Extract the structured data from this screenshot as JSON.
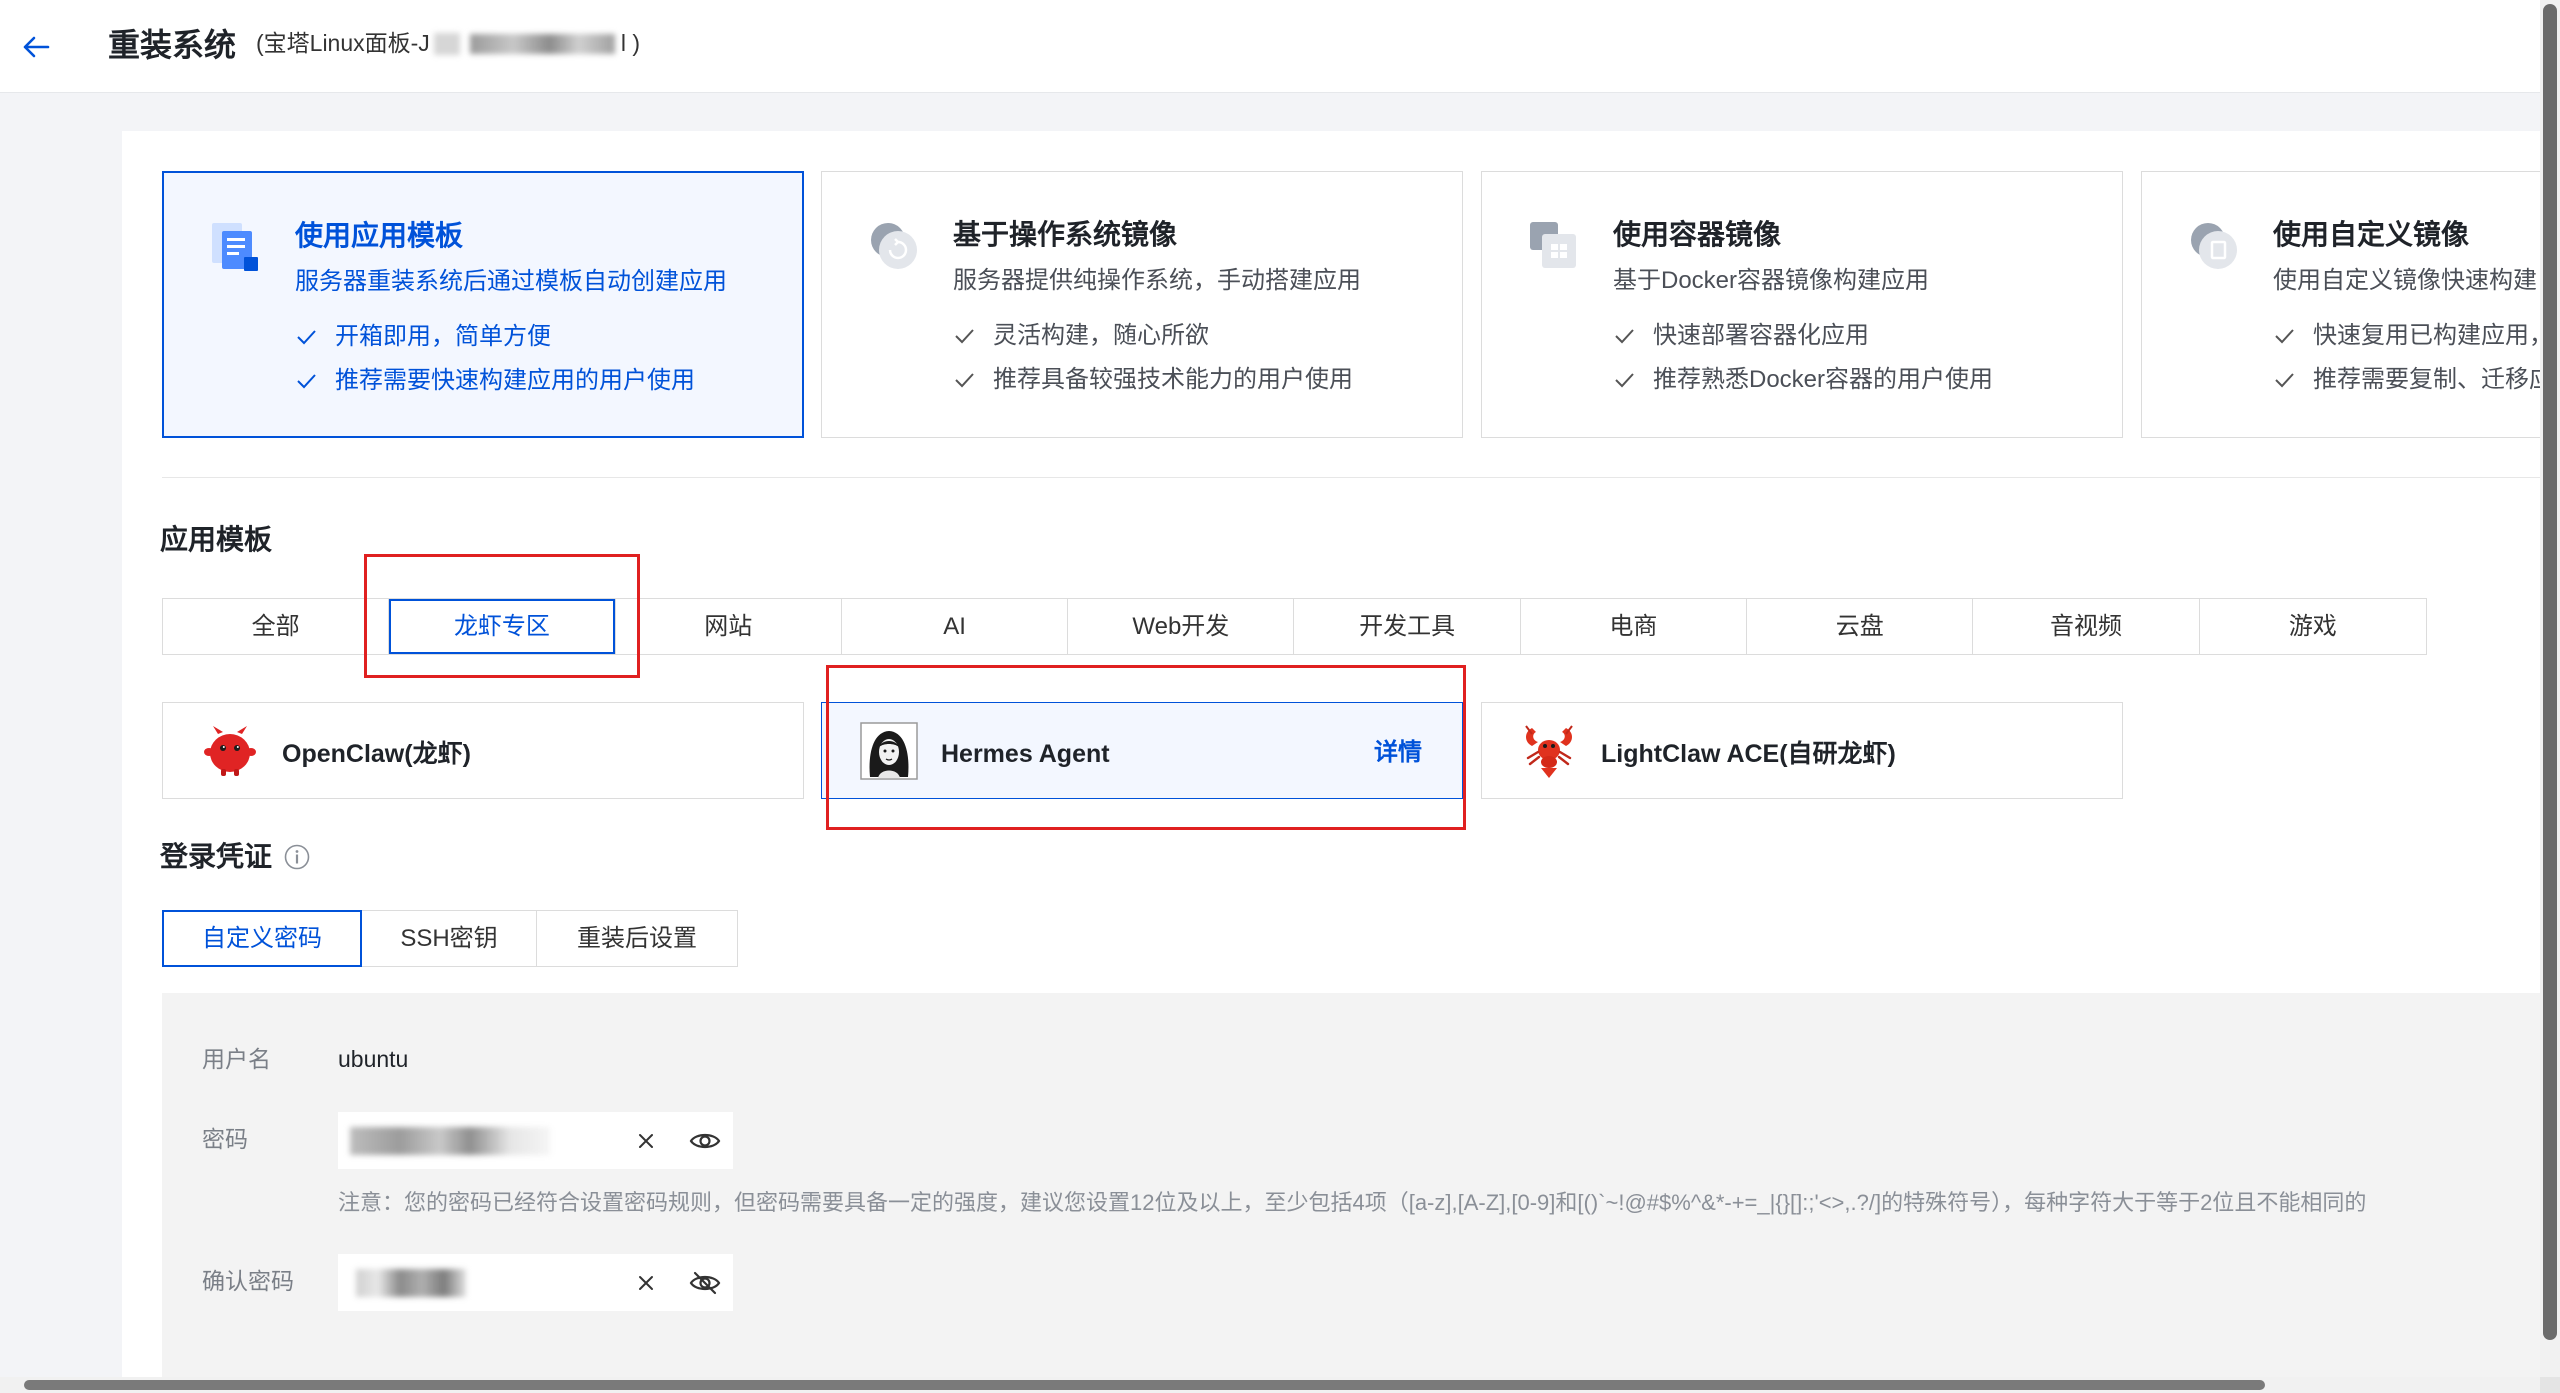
{
  "header": {
    "title": "重装系统",
    "subtitle_prefix": "(宝塔Linux面板-J",
    "subtitle_suffix": "l )",
    "back_icon": "arrow-left-icon"
  },
  "image_types": [
    {
      "title": "使用应用模板",
      "desc": "服务器重装系统后通过模板自动创建应用",
      "features": [
        "开箱即用，简单方便",
        "推荐需要快速构建应用的用户使用"
      ],
      "selected": true,
      "icon": "app-template-icon"
    },
    {
      "title": "基于操作系统镜像",
      "desc": "服务器提供纯操作系统，手动搭建应用",
      "features": [
        "灵活构建，随心所欲",
        "推荐具备较强技术能力的用户使用"
      ],
      "selected": false,
      "icon": "os-image-icon"
    },
    {
      "title": "使用容器镜像",
      "desc": "基于Docker容器镜像构建应用",
      "features": [
        "快速部署容器化应用",
        "推荐熟悉Docker容器的用户使用"
      ],
      "selected": false,
      "icon": "container-image-icon"
    },
    {
      "title": "使用自定义镜像",
      "desc": "使用自定义镜像快速构建",
      "features": [
        "快速复用已构建应用，",
        "推荐需要复制、迁移应"
      ],
      "selected": false,
      "icon": "custom-image-icon"
    }
  ],
  "app_template": {
    "title": "应用模板",
    "tabs": [
      "全部",
      "龙虾专区",
      "网站",
      "AI",
      "Web开发",
      "开发工具",
      "电商",
      "云盘",
      "音视频",
      "游戏"
    ],
    "selected_tab_index": 1,
    "apps": [
      {
        "name": "OpenClaw(龙虾)",
        "icon": "openclaw-mascot-icon",
        "selected": false
      },
      {
        "name": "Hermes Agent",
        "icon": "hermes-agent-avatar-icon",
        "selected": true,
        "detail_label": "详情"
      },
      {
        "name": "LightClaw ACE(自研龙虾)",
        "icon": "lobster-icon",
        "selected": false
      }
    ]
  },
  "credentials": {
    "title": "登录凭证",
    "info_icon": "info-circle-icon",
    "tabs": [
      "自定义密码",
      "SSH密钥",
      "重装后设置"
    ],
    "selected_tab_index": 0,
    "username_label": "用户名",
    "username": "ubuntu",
    "password_label": "密码",
    "password_note": "注意：您的密码已经符合设置密码规则，但密码需要具备一定的强度，建议您设置12位及以上，至少包括4项（[a-z],[A-Z],[0-9]和[()`~!@#$%^&*-+=_|{}[]:;'<>,.?/]的特殊符号），每种字符大于等于2位且不能相同的",
    "confirm_password_label": "确认密码",
    "clear_icon": "close-icon",
    "show_password_icon": "eye-icon",
    "hide_password_icon": "eye-off-icon"
  },
  "colors": {
    "accent": "#0052d9",
    "selected_background": "#f3f7ff",
    "annotation": "#e02020"
  }
}
